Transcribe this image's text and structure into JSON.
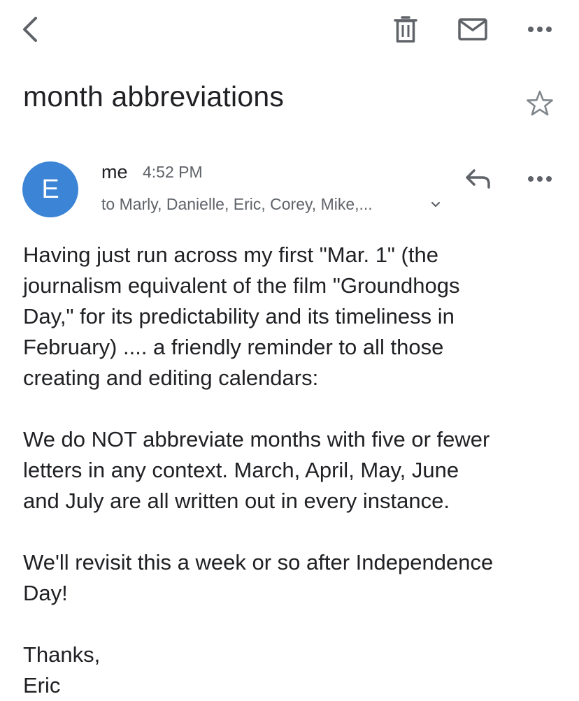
{
  "toolbar": {
    "back_icon": "chevron-left-icon",
    "delete_icon": "trash-icon",
    "mark_unread_icon": "mail-icon",
    "more_icon": "more-horizontal-icon"
  },
  "email": {
    "subject": "month abbreviations",
    "starred": false,
    "sender": {
      "initial": "E",
      "name": "me",
      "avatar_color": "#3b84d6"
    },
    "time": "4:52 PM",
    "recipients": "to Marly, Danielle, Eric, Corey, Mike,...",
    "body": {
      "paragraph_1": "Having just run across my first \"Mar. 1\" (the\njournalism equivalent of the film \"Groundhogs\nDay,\" for its predictability and its timeliness in\nFebruary) .... a friendly reminder to all those\ncreating and editing calendars:",
      "paragraph_2": "We do NOT abbreviate months with five or fewer\nletters in any context. March, April, May, June\nand July are all written out in every instance.",
      "paragraph_3": "We'll revisit this a week or so after Independence\nDay!",
      "signoff": "Thanks,\nEric"
    }
  },
  "colors": {
    "text_primary": "#202124",
    "text_secondary": "#5f6368",
    "icon": "#5f6368",
    "avatar": "#3b84d6"
  }
}
